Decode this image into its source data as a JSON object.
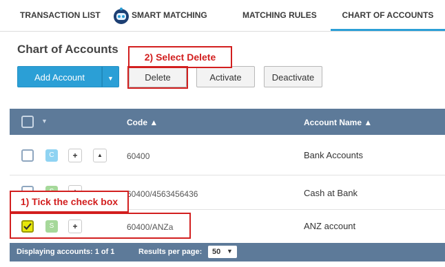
{
  "tabs": {
    "transaction_list": "TRANSACTION LIST",
    "smart_matching": "SMART MATCHING",
    "matching_rules": "MATCHING RULES",
    "chart_of_accounts": "CHART OF ACCOUNTS"
  },
  "page_title": "Chart of Accounts",
  "toolbar": {
    "add_account": "Add Account",
    "delete": "Delete",
    "activate": "Activate",
    "deactivate": "Deactivate"
  },
  "annotations": {
    "step2": "2) Select Delete",
    "step1": "1) Tick the check box"
  },
  "grid": {
    "columns": {
      "code": "Code ▲",
      "account_name": "Account Name ▲"
    },
    "rows": [
      {
        "badge": "C",
        "code": "60400",
        "name": "Bank Accounts",
        "checked": false
      },
      {
        "badge": "S",
        "code": "60400/4563456436",
        "name": "Cash at Bank",
        "checked": false
      },
      {
        "badge": "S",
        "code": "60400/ANZa",
        "name": "ANZ account",
        "checked": true
      }
    ]
  },
  "footer": {
    "displaying": "Displaying accounts: 1 of 1",
    "results_label": "Results per page:",
    "results_value": "50"
  },
  "colors": {
    "accent": "#2b9fd6",
    "header_bg": "#5d7a99",
    "callout": "#d21e1e",
    "badge_c": "#8fd3f2",
    "badge_s": "#a6d89a",
    "checked": "#e8e80a"
  }
}
